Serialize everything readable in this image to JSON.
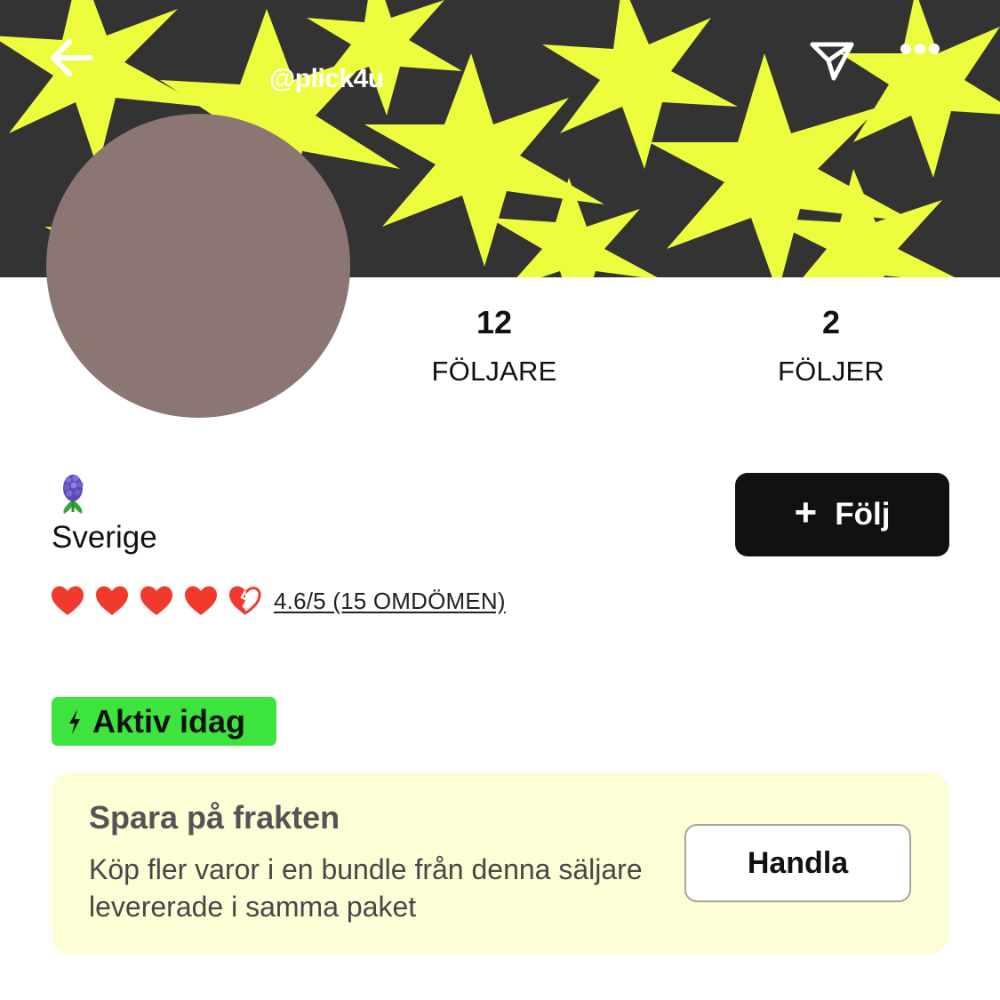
{
  "header": {
    "handle": "@plick4u",
    "back_icon": "back-arrow-icon",
    "share_icon": "send-icon",
    "more_icon": "more-dots-icon",
    "banner_colors": {
      "background": "#333333",
      "stars": "#eefc3e"
    }
  },
  "profile": {
    "avatar_color": "#8b7674",
    "emoji": "hyacinth",
    "location": "Sverige"
  },
  "stats": [
    {
      "value": "12",
      "label": "FÖLJARE"
    },
    {
      "value": "2",
      "label": "FÖLJER"
    }
  ],
  "follow_button": {
    "icon": "+",
    "label": "Följ"
  },
  "rating": {
    "score": 4.6,
    "max": 5,
    "hearts_full": 4,
    "hearts_half": 1,
    "heart_color": "#f03a2e",
    "text": "4.6/5 (15 OMDÖMEN)"
  },
  "activity": {
    "label": "Aktiv idag",
    "color": "#3ee43e"
  },
  "bundle": {
    "title": "Spara på frakten",
    "description": "Köp fler varor i en bundle från denna säljare levererade i samma paket",
    "button_label": "Handla",
    "background": "#fdfdd6"
  }
}
